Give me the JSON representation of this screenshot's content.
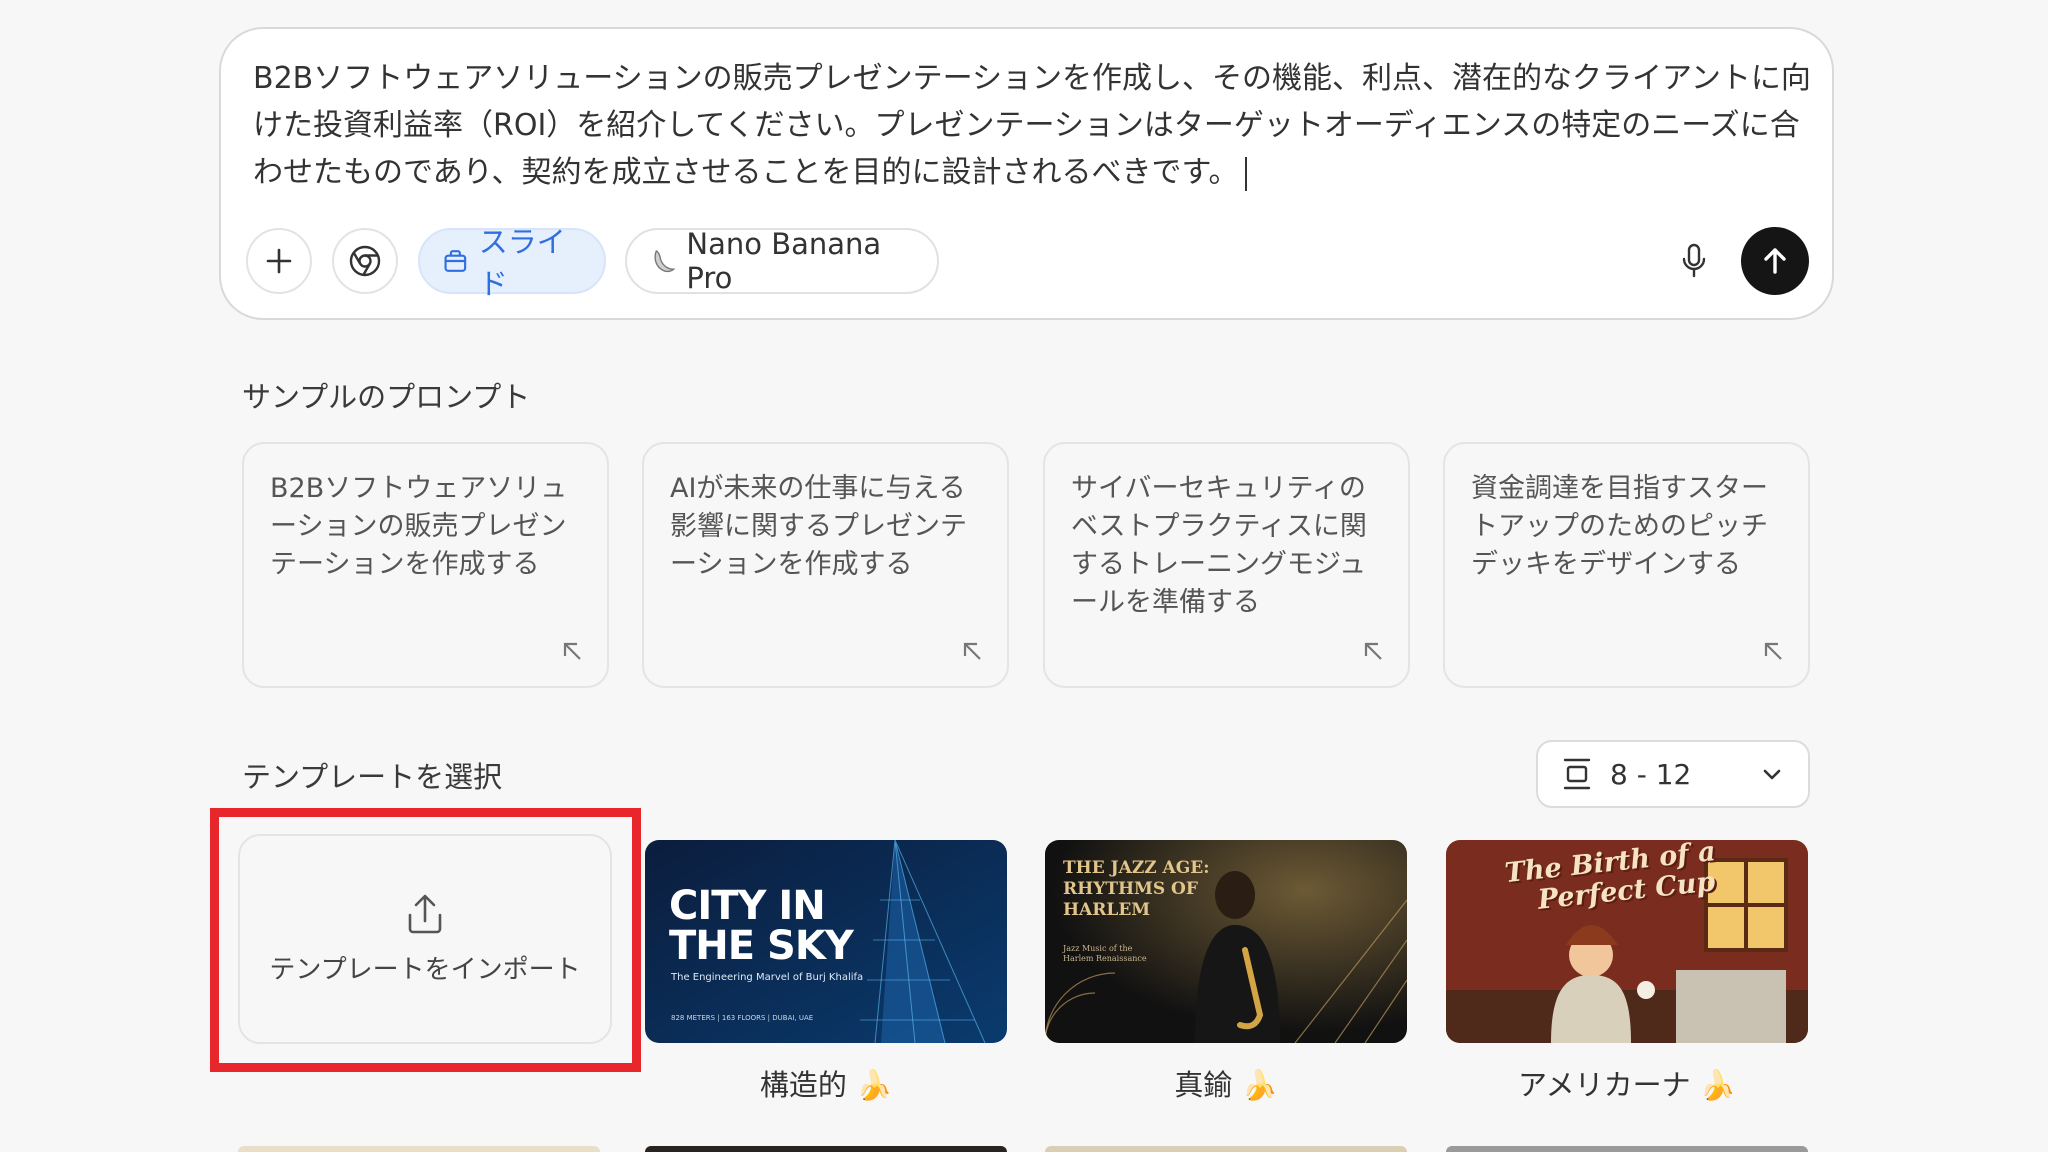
{
  "prompt": {
    "text": "B2Bソフトウェアソリューションの販売プレゼンテーションを作成し、その機能、利点、潜在的なクライアントに向けた投資利益率（ROI）を紹介してください。プレゼンテーションはターゲットオーディエンスの特定のニーズに合わせたものであり、契約を成立させることを目的に設計されるべきです。",
    "add_icon": "plus-icon",
    "browse_icon": "chrome-icon",
    "slides_chip": "スライド",
    "model_chip": "Nano Banana Pro",
    "mic_icon": "microphone-icon",
    "send_icon": "arrow-up-icon"
  },
  "samples": {
    "title": "サンプルのプロンプト",
    "cards": [
      {
        "text": "B2Bソフトウェアソリューションの販売プレゼンテーションを作成する"
      },
      {
        "text": "AIが未来の仕事に与える影響に関するプレゼンテーションを作成する"
      },
      {
        "text": "サイバーセキュリティのベストプラクティスに関するトレーニングモジュールを準備する"
      },
      {
        "text": "資金調達を目指すスタートアップのためのピッチデッキをデザインする"
      }
    ]
  },
  "templates": {
    "title": "テンプレートを選択",
    "range": "8 - 12",
    "import_label": "テンプレートをインポート",
    "items": [
      {
        "caption": "構造的 🍌",
        "thumb_title_1": "CITY IN",
        "thumb_title_2": "THE SKY",
        "thumb_sub": "The Engineering Marvel of Burj Khalifa",
        "thumb_foot": "828 METERS | 163 FLOORS | DUBAI, UAE"
      },
      {
        "caption": "真鍮 🍌",
        "thumb_title_1": "THE JAZZ AGE:",
        "thumb_title_2": "RHYTHMS OF",
        "thumb_title_3": "HARLEM",
        "thumb_sub": "Jazz Music of the Harlem Renaissance"
      },
      {
        "caption": "アメリカーナ 🍌",
        "thumb_title_1": "The Birth of a",
        "thumb_title_2": "Perfect Cup"
      }
    ]
  },
  "colors": {
    "accent_blue": "#2f6fe0",
    "highlight_red": "#e8272c",
    "send_bg": "#151515"
  }
}
